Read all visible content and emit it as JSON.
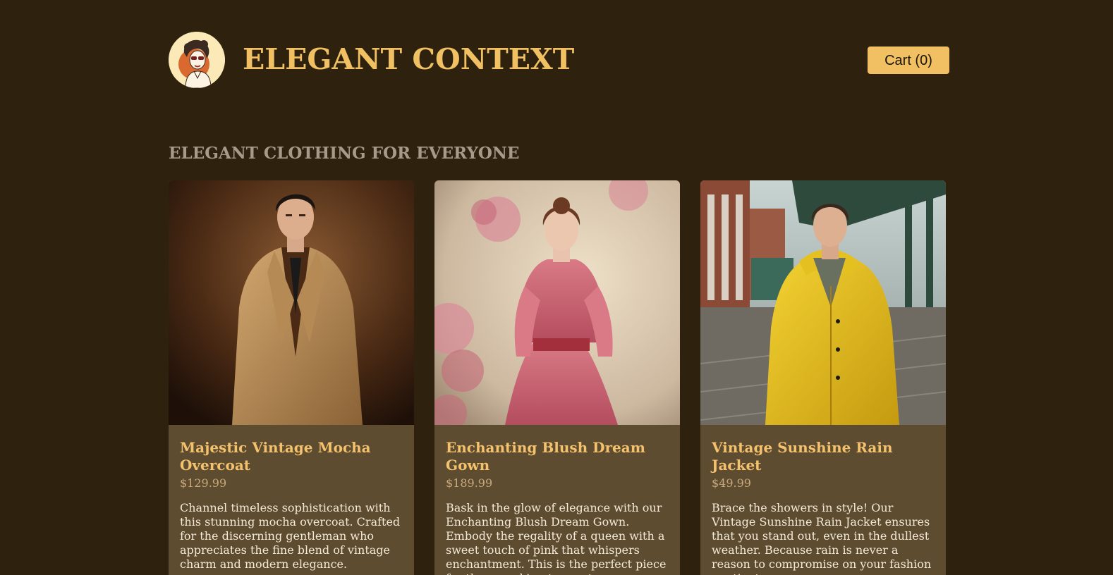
{
  "header": {
    "brand": "ELEGANT CONTEXT",
    "cart_label": "Cart (0)"
  },
  "main": {
    "section_title": "ELEGANT CLOTHING FOR EVERYONE",
    "products": [
      {
        "title": "Majestic Vintage Mocha Overcoat",
        "price": "$129.99",
        "description": "Channel timeless sophistication with this stunning mocha overcoat. Crafted for the discerning gentleman who appreciates the fine blend of vintage charm and modern elegance.",
        "image": "man-in-mocha-overcoat-photo"
      },
      {
        "title": "Enchanting Blush Dream Gown",
        "price": "$189.99",
        "description": "Bask in the glow of elegance with our Enchanting Blush Dream Gown. Embody the regality of a queen with a sweet touch of pink that whispers enchantment. This is the perfect piece for those seeking to create unforgettable moments.",
        "image": "woman-in-pink-gown-photo"
      },
      {
        "title": "Vintage Sunshine Rain Jacket",
        "price": "$49.99",
        "description": "Brace the showers in style! Our Vintage Sunshine Rain Jacket ensures that you stand out, even in the dullest weather. Because rain is never a reason to compromise on your fashion quotient.",
        "image": "man-in-yellow-rain-jacket-photo"
      }
    ]
  },
  "colors": {
    "background": "#2e220f",
    "accent": "#f0c063",
    "card_background": "#5e4c31",
    "section_title": "#a59b88"
  }
}
